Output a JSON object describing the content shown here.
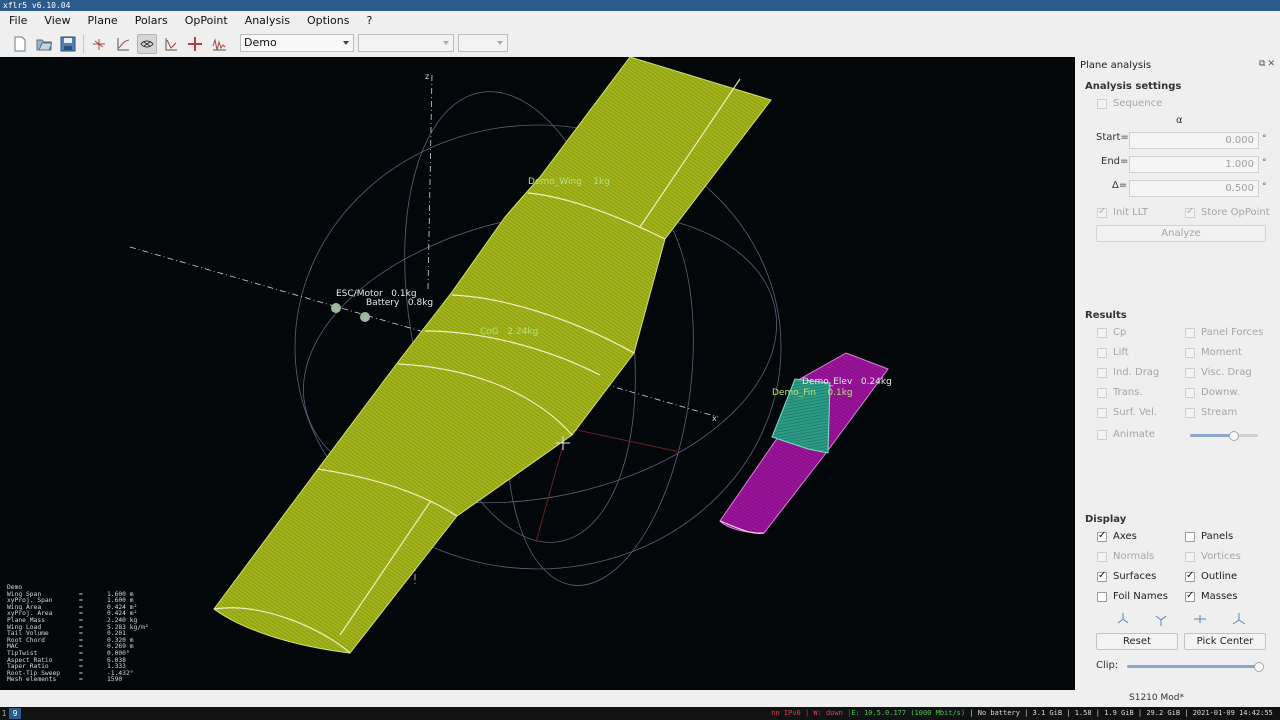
{
  "window": {
    "title": "xflr5 v6.10.04"
  },
  "menu": [
    "File",
    "View",
    "Plane",
    "Polars",
    "OpPoint",
    "Analysis",
    "Options",
    "?"
  ],
  "toolbar": {
    "plane_combo": "Demo",
    "polar_combo": "",
    "oppoint_combo": ""
  },
  "viewport": {
    "labels": {
      "wing": "Demo_Wing    1kg",
      "esc": "ESC/Motor   0.1kg",
      "battery": "Battery   0.8kg",
      "cog": "CoG   2.24kg",
      "elev": "Demo_Elev   0.24kg",
      "fin": "Demo_Fin    0.1kg"
    },
    "stats_title": "Demo",
    "stats": [
      {
        "k": "Wing Span",
        "v": "1.600 m"
      },
      {
        "k": "xyProj. Span",
        "v": "1.600 m"
      },
      {
        "k": "Wing Area",
        "v": "0.424 m²"
      },
      {
        "k": "xyProj. Area",
        "v": "0.424 m²"
      },
      {
        "k": "Plane Mass",
        "v": "2.240 kg"
      },
      {
        "k": "Wing Load",
        "v": "5.283 kg/m²"
      },
      {
        "k": "Tail Volume",
        "v": "0.201"
      },
      {
        "k": "Root Chord",
        "v": "0.320 m"
      },
      {
        "k": "MAC",
        "v": "0.269 m"
      },
      {
        "k": "TipTwist",
        "v": "0.000°"
      },
      {
        "k": "Aspect Ratio",
        "v": "6.038"
      },
      {
        "k": "Taper Ratio",
        "v": "1.333"
      },
      {
        "k": "Root-Tip Sweep",
        "v": "-1.432°"
      },
      {
        "k": "Mesh elements",
        "v": "1590"
      }
    ]
  },
  "panel": {
    "title": "Plane analysis",
    "analysis_settings": "Analysis settings",
    "sequence": "Sequence",
    "alpha": "α",
    "start_label": "Start=",
    "end_label": "End=",
    "delta_label": "Δ=",
    "start_value": "0.000",
    "end_value": "1.000",
    "delta_value": "0.500",
    "unit": "°",
    "init_llt": "Init LLT",
    "store_oppoint": "Store OpPoint",
    "analyze": "Analyze",
    "results": "Results",
    "results_items": [
      "Cp",
      "Panel Forces",
      "Lift",
      "Moment",
      "Ind. Drag",
      "Visc. Drag",
      "Trans.",
      "Downw.",
      "Surf. Vel.",
      "Stream"
    ],
    "animate": "Animate",
    "animate_speed": 0.65,
    "display": "Display",
    "display_items": [
      {
        "label": "Axes",
        "checked": true,
        "enabled": true
      },
      {
        "label": "Panels",
        "checked": false,
        "enabled": true
      },
      {
        "label": "Normals",
        "checked": false,
        "enabled": false
      },
      {
        "label": "Vortices",
        "checked": false,
        "enabled": false
      },
      {
        "label": "Surfaces",
        "checked": true,
        "enabled": true
      },
      {
        "label": "Outline",
        "checked": true,
        "enabled": true
      },
      {
        "label": "Foil Names",
        "checked": false,
        "enabled": true
      },
      {
        "label": "Masses",
        "checked": true,
        "enabled": true
      }
    ],
    "reset": "Reset",
    "pick_center": "Pick Center",
    "clip": "Clip:",
    "clip_value": 1.0,
    "status": "S1210 Mod*"
  },
  "taskbar": {
    "workspaces": [
      "1",
      "9"
    ],
    "sys_red": "no IPv6 | W: down |",
    "sys_green": "E: 10.5.0.177 (1000 Mbit/s)",
    "sys_rest": " | No battery | 3.1 GiB | 1.58 | 1.9 GiB | 29.2 GiB | 2021-01-09 14:42:55 "
  },
  "colors": {
    "wing": "#a7b81c",
    "tail": "#9b169b",
    "fin": "#2a9a86",
    "viewport_bg": "#04070a"
  }
}
